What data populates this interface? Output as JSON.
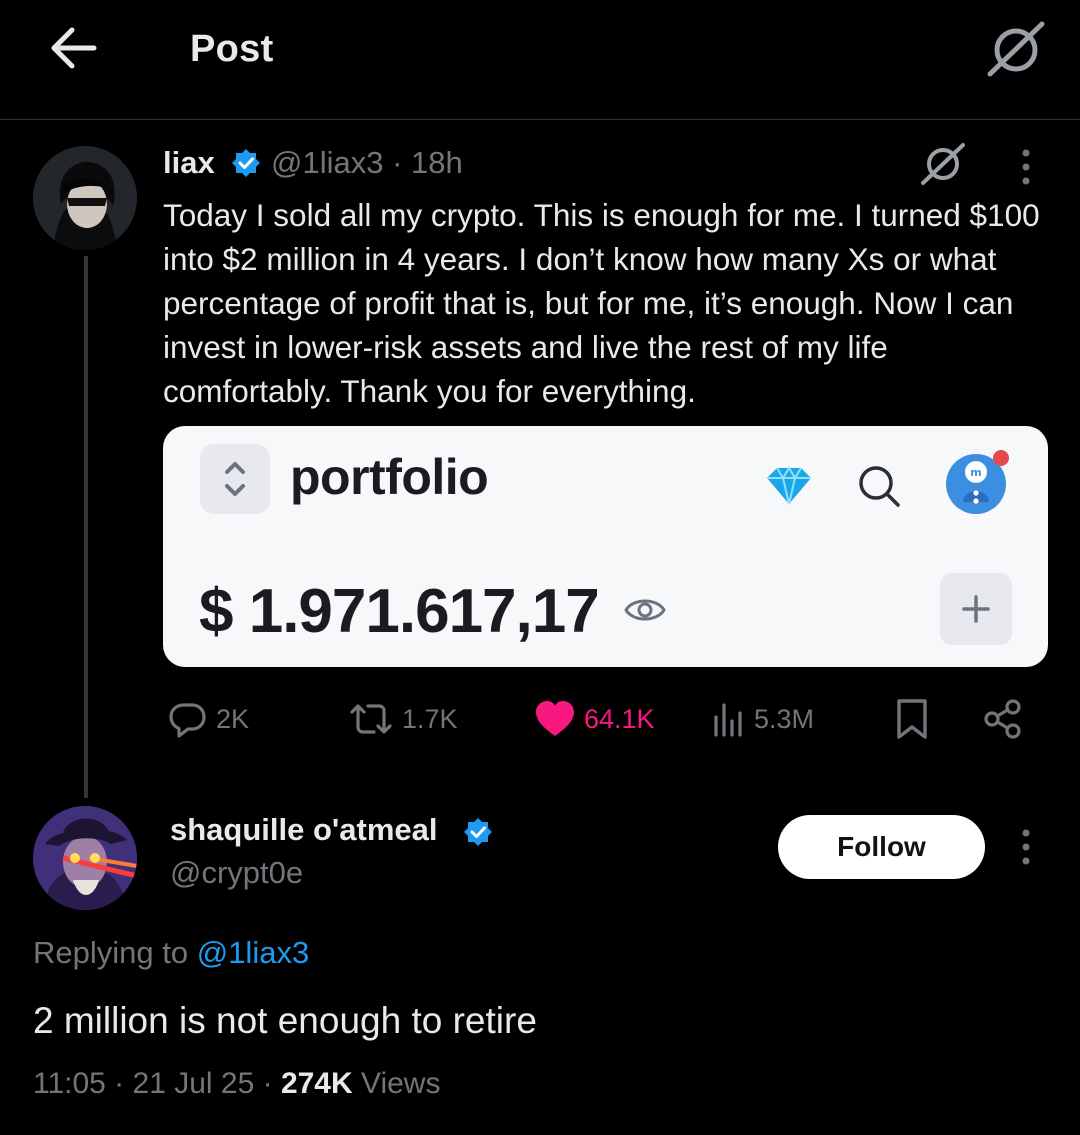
{
  "header": {
    "title": "Post"
  },
  "post": {
    "author_name": "liax",
    "handle_time": "@1liax3 · 18h",
    "text": "Today I sold all my crypto. This is enough for me. I turned $100 into $2 million in 4 years. I don’t know how many Xs or what percentage of profit that is, but for me, it’s enough. Now I can invest in lower-risk assets and live the rest of my life comfortably. Thank you for everything.",
    "image": {
      "title": "portfolio",
      "amount": "$ 1.971.617,17"
    },
    "actions": {
      "replies": "2K",
      "reposts": "1.7K",
      "likes": "64.1K",
      "views": "5.3M"
    }
  },
  "reply": {
    "author_name": "shaquille o'atmeal",
    "handle": "@crypt0e",
    "follow_label": "Follow",
    "replying_prefix": "Replying to",
    "replying_handle": "@1liax3",
    "text": "2 million is not enough to retire",
    "meta_time": "11:05 · 21 Jul 25 · ",
    "meta_views_count": "274K",
    "meta_views_label": " Views"
  },
  "colors": {
    "background": "#000000",
    "accent": "#1d9bf0",
    "like": "#f91880",
    "muted": "#71767b"
  },
  "icons": [
    "back-arrow-icon",
    "grok-icon",
    "verified-badge-icon",
    "more-icon",
    "reply-icon",
    "repost-icon",
    "like-icon",
    "views-icon",
    "bookmark-icon",
    "share-icon"
  ]
}
